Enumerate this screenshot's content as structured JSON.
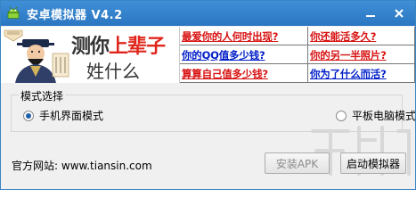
{
  "window": {
    "title": "安卓模拟器 V4.2",
    "icon": "android-robot-icon",
    "minimize_icon": "minimize-icon",
    "close_icon": "close-icon"
  },
  "banner": {
    "ad_headline": {
      "part1": "测你",
      "part2": "上辈子",
      "line2": "姓什么"
    },
    "links": [
      {
        "text": "最爱你的人何时出现?",
        "color": "#d71212"
      },
      {
        "text": "你还能活多久?",
        "color": "#d71212"
      },
      {
        "text": "你的QQ值多少钱?",
        "color": "#001ec8"
      },
      {
        "text": "你的另一半照片?",
        "color": "#d71212"
      },
      {
        "text": "算算自己值多少钱?",
        "color": "#d71212"
      },
      {
        "text": "你为了什么而活?",
        "color": "#001ec8"
      }
    ]
  },
  "mode": {
    "legend": "模式选择",
    "options": [
      {
        "label": "手机界面模式",
        "selected": true
      },
      {
        "label": "平板电脑模式",
        "selected": false
      }
    ]
  },
  "footer": {
    "site_label": "官方网站:",
    "site_url": "www.tiansin.com",
    "install_label": "安装APK",
    "start_label": "启动模拟器"
  },
  "colors": {
    "titlebar": "#2f7fcb",
    "accent_red": "#d71212",
    "accent_blue": "#001ec8"
  }
}
